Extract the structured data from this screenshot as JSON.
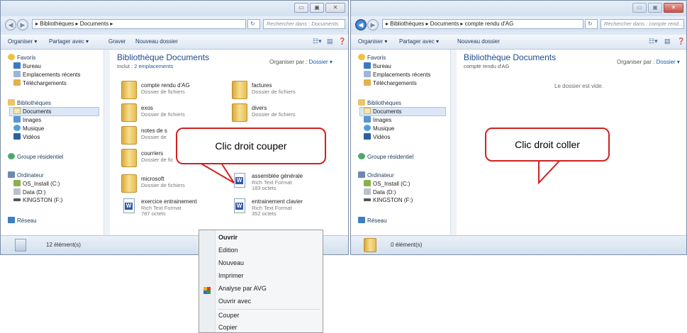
{
  "left_window": {
    "breadcrumb": "▸ Bibliothèques ▸ Documents ▸",
    "search_placeholder": "Rechercher dans : Documents",
    "toolbar": {
      "organiser": "Organiser ▾",
      "partager": "Partager avec ▾",
      "graver": "Graver",
      "nouveau": "Nouveau dossier"
    },
    "library_title": "Bibliothèque Documents",
    "library_includes_prefix": "Inclut : ",
    "library_includes_link": "2 emplacements",
    "organise_label": "Organiser par :",
    "organise_value": "Dossier ▾",
    "nav": {
      "favoris": "Favoris",
      "bureau": "Bureau",
      "recents": "Emplacements récents",
      "telechargements": "Téléchargements",
      "bibliotheques": "Bibliothèques",
      "documents": "Documents",
      "images": "Images",
      "musique": "Musique",
      "videos": "Vidéos",
      "groupe": "Groupe résidentiel",
      "ordinateur": "Ordinateur",
      "os": "OS_Install (C:)",
      "data": "Data (D:)",
      "kingston": "KINGSTON (F:)",
      "reseau": "Réseau"
    },
    "items": [
      {
        "name": "compte rendu d'AG",
        "type": "Dossier de fichiers"
      },
      {
        "name": "factures",
        "type": "Dossier de fichiers"
      },
      {
        "name": "exos",
        "type": "Dossier de fichiers"
      },
      {
        "name": "divers",
        "type": "Dossier de fichiers"
      },
      {
        "name": "notes de s",
        "type": "Dossier de"
      },
      {
        "name": "courriers",
        "type": "Dossier de fic"
      },
      {
        "name": "microsoft",
        "type": "Dossier de fichiers"
      },
      {
        "name": "assemblée générale",
        "type": "Rich Text Format",
        "size": "183 octets"
      },
      {
        "name": "exercice entrainement",
        "type": "Rich Text Format",
        "size": "787 octets"
      },
      {
        "name": "entrainement clavier",
        "type": "Rich Text Format",
        "size": "352 octets"
      }
    ],
    "status_count": "12 élément(s)"
  },
  "right_window": {
    "breadcrumb": "▸ Bibliothèques ▸ Documents ▸ compte rendu d'AG",
    "search_placeholder": "Rechercher dans : compte rend...",
    "toolbar": {
      "organiser": "Organiser ▾",
      "partager": "Partager avec ▾",
      "nouveau": "Nouveau dossier"
    },
    "library_title": "Bibliothèque Documents",
    "library_sub": "compte rendu d'AG",
    "organise_label": "Organiser par :",
    "organise_value": "Dossier ▾",
    "empty_text": "Le dossier est vide.",
    "nav": {
      "favoris": "Favoris",
      "bureau": "Bureau",
      "recents": "Emplacements récents",
      "telechargements": "Téléchargements",
      "bibliotheques": "Bibliothèques",
      "documents": "Documents",
      "images": "Images",
      "musique": "Musique",
      "videos": "Vidéos",
      "groupe": "Groupe résidentiel",
      "ordinateur": "Ordinateur",
      "os": "OS_Install (C:)",
      "data": "Data (D:)",
      "kingston": "KINGSTON (F:)",
      "reseau": "Réseau"
    },
    "status_count": "0 élément(s)"
  },
  "callouts": {
    "left": "Clic droit couper",
    "right": "Clic droit coller"
  },
  "context_menu": {
    "items": [
      "Ouvrir",
      "Edition",
      "Nouveau",
      "Imprimer",
      "Analyse par AVG",
      "Ouvrir avec",
      "Couper",
      "Copier"
    ]
  },
  "colors": {
    "callout_border": "#d32020",
    "link": "#1a5aa8",
    "title": "#1e4b8b"
  },
  "icons": [
    "back-icon",
    "forward-icon",
    "folder-icon",
    "rtf-document-icon",
    "star-icon",
    "computer-icon",
    "network-icon",
    "avg-icon"
  ]
}
